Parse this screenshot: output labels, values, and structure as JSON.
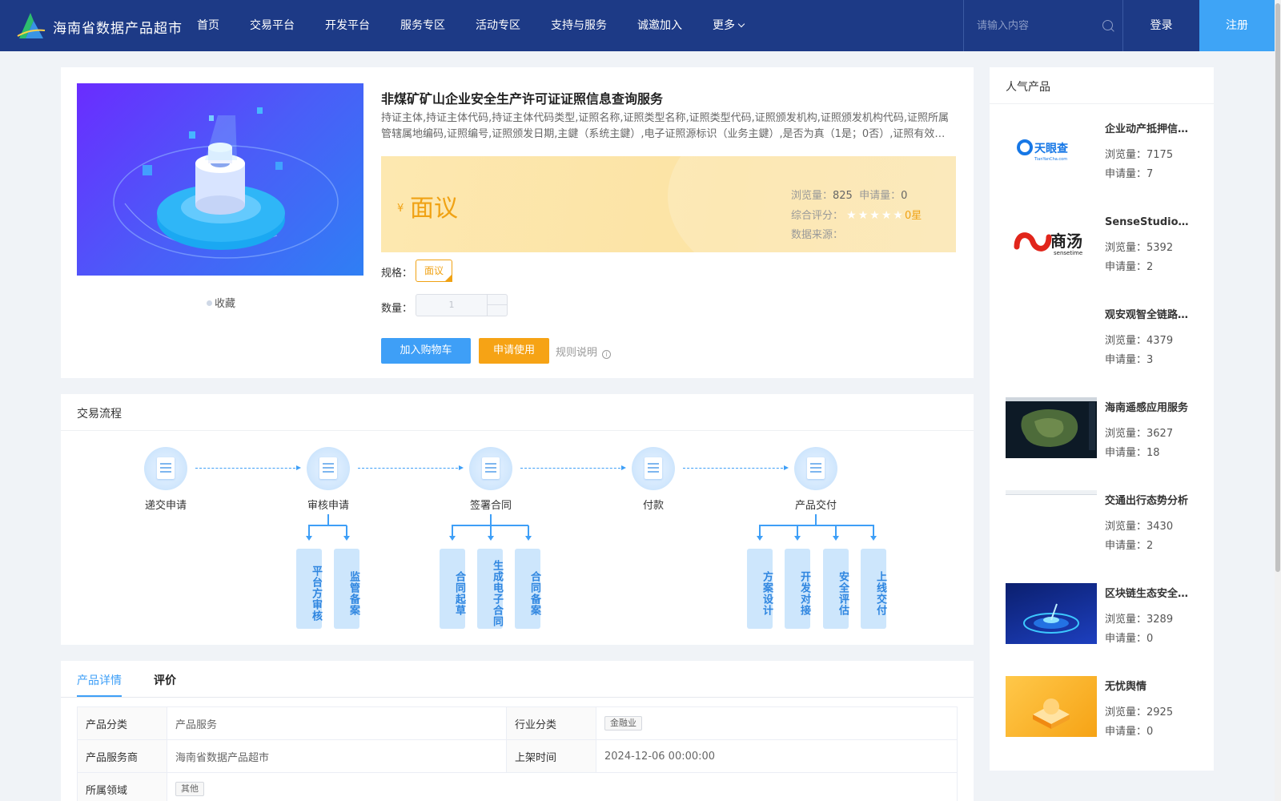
{
  "header": {
    "brand": "海南省数据产品超市",
    "nav": [
      "首页",
      "交易平台",
      "开发平台",
      "服务专区",
      "活动专区",
      "支持与服务",
      "诚邀加入",
      "更多"
    ],
    "search_placeholder": "请输入内容",
    "login": "登录",
    "register": "注册",
    "bg_color": "#1d3a86",
    "accent": "#3ea4f6"
  },
  "product": {
    "title": "非煤矿矿山企业安全生产许可证证照信息查询服务",
    "description": "持证主体,持证主体代码,持证主体代码类型,证照名称,证照类型名称,证照类型代码,证照颁发机构,证照颁发机构代码,证照所属管辖属地编码,证照编号,证照颁发日期,主鍵（系统主鍵）,电子证照源标识（业务主鍵）,是否为真（1是；0否）,证照有效期截止日期,证照有效期起始日期,证照状态",
    "favorite": "收藏",
    "price_symbol": "¥",
    "price": "面议",
    "views_label": "浏览量：",
    "views": "825",
    "applies_label": "申请量：",
    "applies": "0",
    "rating_label": "综合评分：",
    "rating": "0星",
    "rating_stars": 0,
    "source_label": "数据来源：",
    "spec_label": "规格：",
    "spec_value": "面议",
    "qty_label": "数量：",
    "qty_value": "1",
    "add_cart": "加入购物车",
    "apply": "申请使用",
    "rules": "规则说明"
  },
  "flow": {
    "title": "交易流程",
    "steps": [
      "递交申请",
      "审核申请",
      "签署合同",
      "付款",
      "产品交付"
    ],
    "sub_review": [
      "平台方审核",
      "监管备案"
    ],
    "sub_contract": [
      "合同起草",
      "生成电子合同",
      "合同备案"
    ],
    "sub_delivery": [
      "方案设计",
      "开发对接",
      "安全评估",
      "上线交付"
    ]
  },
  "detail": {
    "tabs": [
      "产品详情",
      "评价"
    ],
    "rows": [
      {
        "k1": "产品分类",
        "v1": "产品服务",
        "k2": "行业分类",
        "v2": "金融业"
      },
      {
        "k1": "产品服务商",
        "v1": "海南省数据产品超市",
        "k2": "上架时间",
        "v2": "2024-12-06 00:00:00"
      },
      {
        "k1": "所属领域",
        "v1": "其他"
      }
    ]
  },
  "popular": {
    "title": "人气产品",
    "views_label": "浏览量：",
    "applies_label": "申请量：",
    "items": [
      {
        "name": "企业动产抵押信息查询",
        "views": "7175",
        "applies": "7",
        "logo_text": "天眼查",
        "logo_sub": "TianYanCha.com"
      },
      {
        "name": "SenseStudio智能开发平台",
        "views": "5392",
        "applies": "2",
        "logo_text": "商汤",
        "logo_sub": "sensetime"
      },
      {
        "name": "观安观智全链路数据安全",
        "views": "4379",
        "applies": "3"
      },
      {
        "name": "海南遥感应用服务",
        "views": "3627",
        "applies": "18"
      },
      {
        "name": "交通出行态势分析",
        "views": "3430",
        "applies": "2"
      },
      {
        "name": "区块链生态安全服务",
        "views": "3289",
        "applies": "0"
      },
      {
        "name": "无忧舆情",
        "views": "2925",
        "applies": "0"
      }
    ]
  }
}
